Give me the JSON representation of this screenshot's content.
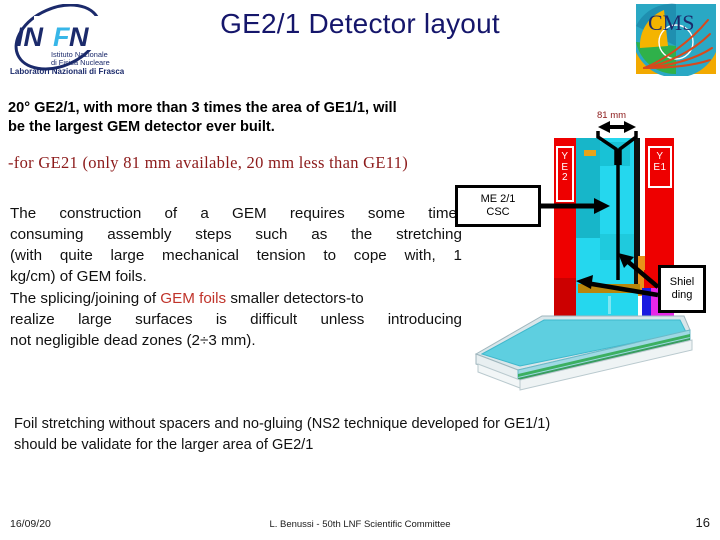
{
  "title": "GE2/1 Detector layout",
  "logos": {
    "infn": {
      "acronym": "INFN",
      "line1": "Istituto Nazionale",
      "line2": "di Fisica Nucleare",
      "line3": "Laboratori Nazionali di Frascati"
    },
    "cms": {
      "label": "CMS"
    }
  },
  "intro": {
    "line1": "20° GE2/1, with more than 3 times the area of GE1/1, will",
    "line2": "be the largest GEM detector ever built."
  },
  "note": "-for GE21 (only 81 mm available, 20 mm less than GE11)",
  "paragraph": {
    "l1a": "The",
    "l1b": "construction",
    "l1c": "of",
    "l1d": "a",
    "l1e": "GEM",
    "l1f": "requires",
    "l1g": "some",
    "l1h": "time-",
    "l2a": "consuming",
    "l2b": "assembly",
    "l2c": "steps",
    "l2d": "such",
    "l2e": "as",
    "l2f": "the",
    "l2g": "stretching",
    "l3a": "(with",
    "l3b": "quite",
    "l3c": "large",
    "l3d": "mechanical",
    "l3e": "tension",
    "l3f": "to",
    "l3g": "cope",
    "l3h": "with,",
    "l3i": "1",
    "l4": "kg/cm) of  GEM foils.",
    "l5a": "The splicing/joining of ",
    "l5hl": "GEM foils",
    "l5b": " smaller detectors-to",
    "l6a": "realize",
    "l6b": "large",
    "l6c": "surfaces",
    "l6d": "is",
    "l6e": "difficult",
    "l6f": "unless",
    "l6g": "introducing",
    "l7": "not negligible dead zones (2÷3 mm)."
  },
  "closing": {
    "line1": "Foil stretching without spacers and no-gluing (NS2 technique developed for GE1/1)",
    "line2": "should be validate for the larger area of GE2/1"
  },
  "diagram": {
    "dimension_label": "81 mm",
    "yoke_left": {
      "l1": "Y",
      "l2": "E",
      "l3": "2"
    },
    "yoke_right": {
      "l1": "Y",
      "l2": "E1"
    },
    "callout_csc": {
      "l1": "ME 2/1",
      "l2": "CSC"
    },
    "callout_shielding": {
      "l1": "Shiel",
      "l2": "ding"
    }
  },
  "footer": {
    "date": "16/09/20",
    "center": "L. Benussi  - 50th LNF Scientific Committee",
    "page": "16"
  },
  "colors": {
    "title": "#15166b",
    "accent_red": "#8c1a1a",
    "highlight_red": "#c0342b",
    "yoke_red": "#ee0000",
    "csc_cyan": "#25d7ee",
    "shield_gold": "#c8901a",
    "magenta": "#e827e8"
  }
}
